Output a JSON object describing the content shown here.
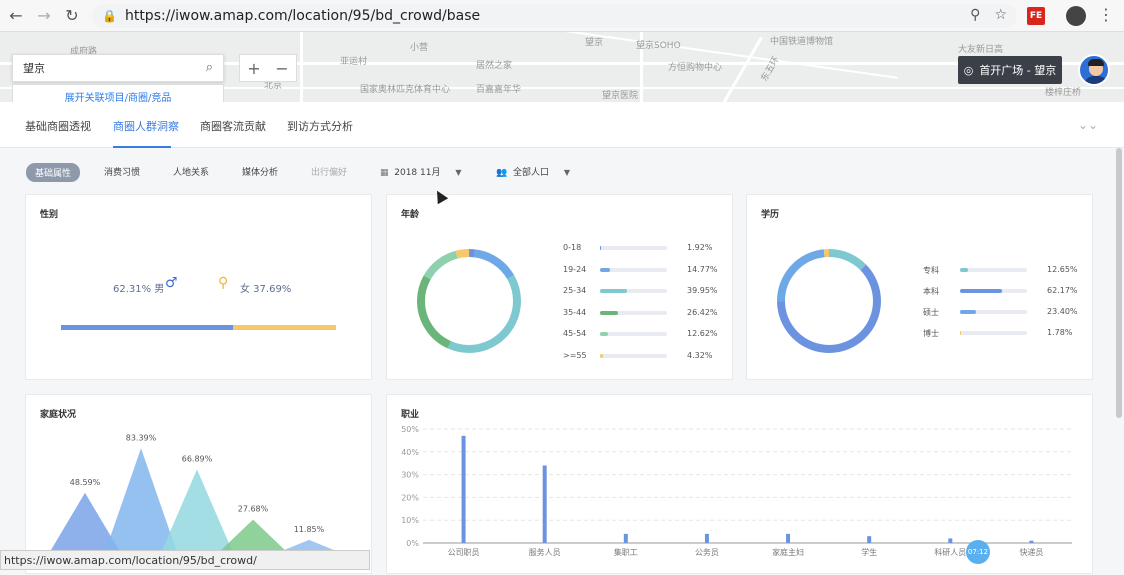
{
  "browser": {
    "url": "https://iwow.amap.com/location/95/bd_crowd/base",
    "extension_label": "FE",
    "status_url": "https://iwow.amap.com/location/95/bd_crowd/"
  },
  "map": {
    "search_value": "望京",
    "expand_link": "展开关联项目/商圈/竞品",
    "zoom_in": "+",
    "zoom_out": "−",
    "poi_label": "首开广场 - 望京",
    "labels": [
      "成府路",
      "亚运村",
      "小营",
      "望京",
      "望京SOHO",
      "中国铁道博物馆",
      "大友新日高",
      "国家奥林匹克体育中心",
      "北京",
      "居然之家",
      "方恒购物中心",
      "东五环",
      "望京医院",
      "百嘉嘉年华",
      "楼梓庄桥"
    ]
  },
  "tabs": [
    "基础商圈透视",
    "商圈人群洞察",
    "商圈客流贡献",
    "到访方式分析"
  ],
  "filters": {
    "items": [
      "基础属性",
      "消费习惯",
      "人地关系",
      "媒体分析",
      "出行偏好"
    ],
    "month": "2018 11月",
    "population": "全部人口"
  },
  "gender": {
    "title": "性别",
    "male_text": "62.31% 男",
    "female_text": "女 37.69%",
    "male_ratio": 0.6231,
    "female_ratio": 0.3769
  },
  "age": {
    "title": "年龄",
    "rows": [
      {
        "label": "0-18",
        "value": "1.92%",
        "pct": 1.92,
        "color": "#6c93e0"
      },
      {
        "label": "19-24",
        "value": "14.77%",
        "pct": 14.77,
        "color": "#6fa8e6"
      },
      {
        "label": "25-34",
        "value": "39.95%",
        "pct": 39.95,
        "color": "#7ec8cf"
      },
      {
        "label": "35-44",
        "value": "26.42%",
        "pct": 26.42,
        "color": "#6bb57a"
      },
      {
        "label": "45-54",
        "value": "12.62%",
        "pct": 12.62,
        "color": "#8fd0ae"
      },
      {
        "label": ">=55",
        "value": "4.32%",
        "pct": 4.32,
        "color": "#f6c86b"
      }
    ]
  },
  "education": {
    "title": "学历",
    "rows": [
      {
        "label": "专科",
        "value": "12.65%",
        "pct": 12.65,
        "color": "#7ec8cf"
      },
      {
        "label": "本科",
        "value": "62.17%",
        "pct": 62.17,
        "color": "#6c93e0"
      },
      {
        "label": "硕士",
        "value": "23.40%",
        "pct": 23.4,
        "color": "#6fa8e6"
      },
      {
        "label": "博士",
        "value": "1.78%",
        "pct": 1.78,
        "color": "#f6c86b"
      }
    ]
  },
  "family": {
    "title": "家庭状况",
    "peaks": [
      {
        "value": "48.59%",
        "pct": 48.59,
        "color": "#7aa2e8"
      },
      {
        "value": "83.39%",
        "pct": 83.39,
        "color": "#82b6ef"
      },
      {
        "value": "66.89%",
        "pct": 66.89,
        "color": "#93d8df"
      },
      {
        "value": "27.68%",
        "pct": 27.68,
        "color": "#7ec98a"
      },
      {
        "value": "11.85%",
        "pct": 11.85,
        "color": "#8fbcef"
      }
    ]
  },
  "chart_data": {
    "type": "bar",
    "title": "职业",
    "categories": [
      "公司职员",
      "服务人员",
      "集职工",
      "公务员",
      "家庭主妇",
      "学生",
      "科研人员",
      "快递员"
    ],
    "values": [
      47,
      34,
      4,
      4,
      4,
      3,
      2,
      1
    ],
    "yticks": [
      "0%",
      "10%",
      "20%",
      "30%",
      "40%",
      "50%"
    ],
    "ylim": [
      0,
      50
    ],
    "color": "#6c93e0"
  },
  "overlay_time": "07:12"
}
